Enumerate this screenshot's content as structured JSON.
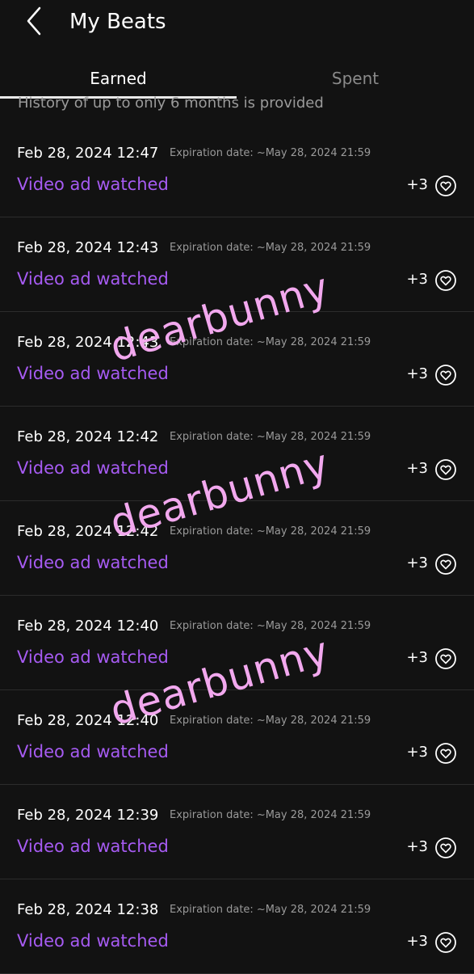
{
  "header": {
    "title": "My Beats"
  },
  "tabs": [
    {
      "label": "Earned"
    },
    {
      "label": "Spent"
    }
  ],
  "notice": "History of up to only 6 months is provided",
  "labels": {
    "expiration": "Expiration date:"
  },
  "entries": [
    {
      "date": "Feb 28, 2024 12:47",
      "expiration": "~May 28, 2024 21:59",
      "description": "Video ad watched",
      "amount": "+3"
    },
    {
      "date": "Feb 28, 2024 12:43",
      "expiration": "~May 28, 2024 21:59",
      "description": "Video ad watched",
      "amount": "+3"
    },
    {
      "date": "Feb 28, 2024 12:43",
      "expiration": "~May 28, 2024 21:59",
      "description": "Video ad watched",
      "amount": "+3"
    },
    {
      "date": "Feb 28, 2024 12:42",
      "expiration": "~May 28, 2024 21:59",
      "description": "Video ad watched",
      "amount": "+3"
    },
    {
      "date": "Feb 28, 2024 12:42",
      "expiration": "~May 28, 2024 21:59",
      "description": "Video ad watched",
      "amount": "+3"
    },
    {
      "date": "Feb 28, 2024 12:40",
      "expiration": "~May 28, 2024 21:59",
      "description": "Video ad watched",
      "amount": "+3"
    },
    {
      "date": "Feb 28, 2024 12:40",
      "expiration": "~May 28, 2024 21:59",
      "description": "Video ad watched",
      "amount": "+3"
    },
    {
      "date": "Feb 28, 2024 12:39",
      "expiration": "~May 28, 2024 21:59",
      "description": "Video ad watched",
      "amount": "+3"
    },
    {
      "date": "Feb 28, 2024 12:38",
      "expiration": "~May 28, 2024 21:59",
      "description": "Video ad watched",
      "amount": "+3"
    }
  ],
  "watermark": "dearbunny",
  "icons": {
    "back": "chevron-left-icon",
    "heart": "heart-circle-icon"
  },
  "colors": {
    "background": "#121212",
    "accent_purple": "#a65bf2",
    "watermark_pink": "#f2a8ee",
    "muted_text": "#9a9a9a"
  }
}
